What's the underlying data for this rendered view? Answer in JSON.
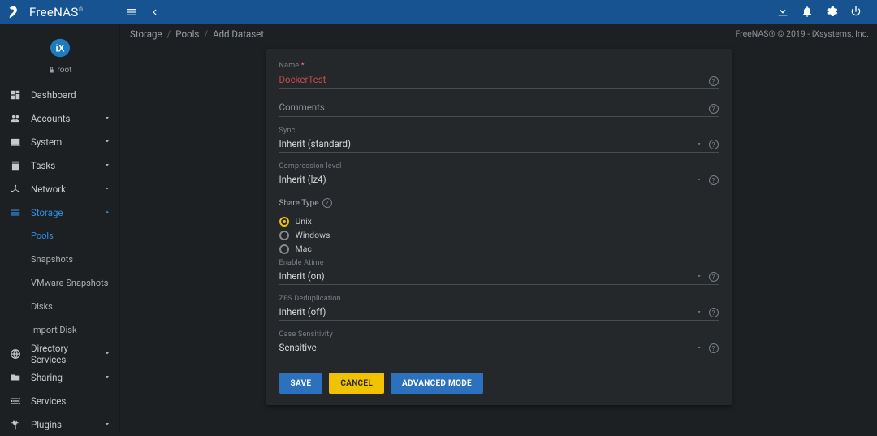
{
  "brand": {
    "name": "FreeNAS",
    "user": "root"
  },
  "topbar": {
    "menu_icon": "menu-icon",
    "back_icon": "chevron-left-icon"
  },
  "sidebar": {
    "items": [
      {
        "icon": "dashboard",
        "label": "Dashboard",
        "expandable": false
      },
      {
        "icon": "accounts",
        "label": "Accounts",
        "expandable": true
      },
      {
        "icon": "system",
        "label": "System",
        "expandable": true
      },
      {
        "icon": "tasks",
        "label": "Tasks",
        "expandable": true
      },
      {
        "icon": "network",
        "label": "Network",
        "expandable": true
      },
      {
        "icon": "storage",
        "label": "Storage",
        "expandable": true,
        "active": true,
        "children": [
          {
            "label": "Pools",
            "active": true
          },
          {
            "label": "Snapshots"
          },
          {
            "label": "VMware-Snapshots"
          },
          {
            "label": "Disks"
          },
          {
            "label": "Import Disk"
          }
        ]
      },
      {
        "icon": "directory",
        "label": "Directory Services",
        "expandable": true
      },
      {
        "icon": "sharing",
        "label": "Sharing",
        "expandable": true
      },
      {
        "icon": "services",
        "label": "Services",
        "expandable": false
      },
      {
        "icon": "plugins",
        "label": "Plugins",
        "expandable": true
      }
    ]
  },
  "breadcrumb": [
    "Storage",
    "Pools",
    "Add Dataset"
  ],
  "footer": "FreeNAS® © 2019 - iXsystems, Inc.",
  "form": {
    "name": {
      "label": "Name",
      "required_mark": "*",
      "value": "DockerTest"
    },
    "comments": {
      "label": "Comments",
      "value": ""
    },
    "sync": {
      "label": "Sync",
      "value": "Inherit (standard)"
    },
    "compression": {
      "label": "Compression level",
      "value": "Inherit (lz4)"
    },
    "share_type": {
      "label": "Share Type",
      "options": [
        {
          "label": "Unix",
          "selected": true
        },
        {
          "label": "Windows",
          "selected": false
        },
        {
          "label": "Mac",
          "selected": false
        }
      ]
    },
    "atime": {
      "label": "Enable Atime",
      "value": "Inherit (on)"
    },
    "dedup": {
      "label": "ZFS Deduplication",
      "value": "Inherit (off)"
    },
    "case_sens": {
      "label": "Case Sensitivity",
      "value": "Sensitive"
    },
    "buttons": {
      "save": "SAVE",
      "cancel": "CANCEL",
      "advanced": "ADVANCED MODE"
    }
  }
}
